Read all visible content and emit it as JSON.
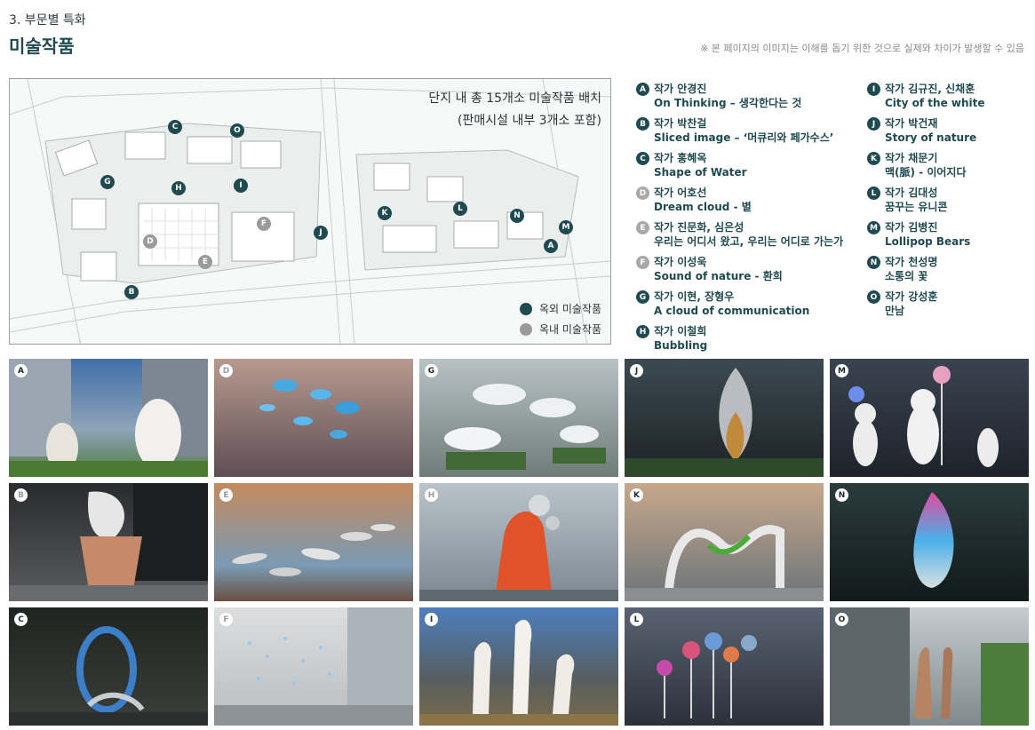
{
  "header": {
    "section_label": "3. 부문별 특화",
    "title": "미술작품",
    "disclaimer": "※ 본 페이지의 이미지는 이해를 돕기 위한 것으로 실제와 차이가 발생할 수 있음"
  },
  "map": {
    "caption_line1": "단지 내 총 15개소 미술작품 배치",
    "caption_line2": "(판매시설 내부 3개소 포함)",
    "legend_outdoor": "옥외 미술작품",
    "legend_indoor": "옥내 미술작품",
    "outdoor_color": "#1f4a50",
    "indoor_color": "#9a9a9a"
  },
  "artists": [
    {
      "id": "A",
      "type": "outdoor",
      "line1": "작가 안경진",
      "line2": "On Thinking – 생각한다는 것"
    },
    {
      "id": "B",
      "type": "outdoor",
      "line1": "작가 박찬걸",
      "line2": "Sliced image – ‘머큐리와 페가수스’"
    },
    {
      "id": "C",
      "type": "outdoor",
      "line1": "작가 홍혜옥",
      "line2": "Shape of Water"
    },
    {
      "id": "D",
      "type": "indoor",
      "line1": "작가 어호선",
      "line2": "Dream cloud - 별"
    },
    {
      "id": "E",
      "type": "indoor",
      "line1": "작가 진문화, 심은성",
      "line2": "우리는 어디서 왔고, 우리는 어디로 가는가"
    },
    {
      "id": "F",
      "type": "indoor",
      "line1": "작가 이성욱",
      "line2": "Sound of nature - 환희"
    },
    {
      "id": "G",
      "type": "outdoor",
      "line1": "작가 이현, 장형우",
      "line2": "A cloud of communication"
    },
    {
      "id": "H",
      "type": "outdoor",
      "line1": "작가 이철희",
      "line2": "Bubbling"
    },
    {
      "id": "I",
      "type": "outdoor",
      "line1": "작가 김규진, 신채훈",
      "line2": "City of the white"
    },
    {
      "id": "J",
      "type": "outdoor",
      "line1": "작가 박건재",
      "line2": "Story of nature"
    },
    {
      "id": "K",
      "type": "outdoor",
      "line1": "작가 채문기",
      "line2": "맥(脈) - 이어지다"
    },
    {
      "id": "L",
      "type": "outdoor",
      "line1": "작가 김대성",
      "line2": "꿈꾸는 유니콘"
    },
    {
      "id": "M",
      "type": "outdoor",
      "line1": "작가 김병진",
      "line2": "Lollipop Bears"
    },
    {
      "id": "N",
      "type": "outdoor",
      "line1": "작가 천성명",
      "line2": "소통의 꽃"
    },
    {
      "id": "O",
      "type": "outdoor",
      "line1": "작가 강성훈",
      "line2": "만남"
    }
  ],
  "tiles": [
    {
      "id": "A",
      "type": "outdoor",
      "bg": "#6d7f93"
    },
    {
      "id": "D",
      "type": "indoor",
      "bg": "#6a5f63"
    },
    {
      "id": "G",
      "type": "outdoor",
      "bg": "#7d8a86"
    },
    {
      "id": "J",
      "type": "outdoor",
      "bg": "#2c3233"
    },
    {
      "id": "M",
      "type": "outdoor",
      "bg": "#2f3640"
    },
    {
      "id": "B",
      "type": "indoor",
      "bg": "#3a3a3d"
    },
    {
      "id": "E",
      "type": "indoor",
      "bg": "#7a5a45"
    },
    {
      "id": "H",
      "type": "outdoor",
      "bg": "#8e9aa3"
    },
    {
      "id": "K",
      "type": "outdoor",
      "bg": "#6e7a82"
    },
    {
      "id": "N",
      "type": "outdoor",
      "bg": "#1e2b2e"
    },
    {
      "id": "C",
      "type": "outdoor",
      "bg": "#2b2f2d"
    },
    {
      "id": "F",
      "type": "indoor",
      "bg": "#c9ccce"
    },
    {
      "id": "I",
      "type": "outdoor",
      "bg": "#4c5356"
    },
    {
      "id": "L",
      "type": "outdoor",
      "bg": "#3d4450"
    },
    {
      "id": "O",
      "type": "outdoor",
      "bg": "#9aa4a9"
    }
  ]
}
